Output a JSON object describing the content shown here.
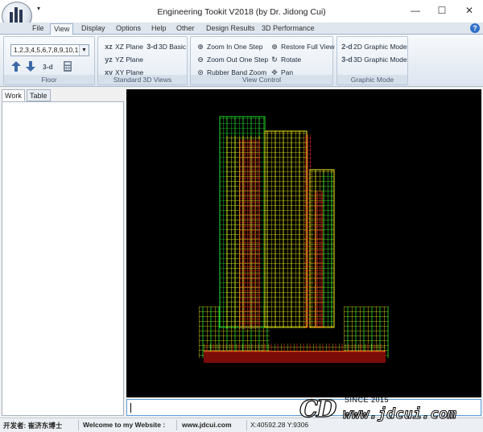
{
  "window": {
    "title": "Engineering Tookit V2018 (by Dr. Jidong Cui)",
    "qat_label": "▾",
    "controls": {
      "minimize": "—",
      "maximize": "☐",
      "close": "✕"
    }
  },
  "menu_tabs": [
    "File",
    "View",
    "Display",
    "Options",
    "Help",
    "Other",
    "Design Results",
    "3D Performance"
  ],
  "active_tab": "View",
  "help_label": "?",
  "ribbon": {
    "floor": {
      "label": "Floor",
      "selected": "1,2,3,4,5,6,7,8,9,10,1",
      "three_d_label": "3-d"
    },
    "standard_views": {
      "label": "Standard 3D Views",
      "buttons": [
        {
          "icon": "xz",
          "label": "XZ Plane"
        },
        {
          "icon": "yz",
          "label": "YZ Plane"
        },
        {
          "icon": "xy",
          "label": "XY Plane"
        },
        {
          "icon": "3-d",
          "label": "3D Basic"
        }
      ]
    },
    "view_control": {
      "label": "View Control",
      "buttons": [
        {
          "icon": "zoom-in-icon",
          "glyph": "⊕",
          "label": "Zoom In One Step"
        },
        {
          "icon": "zoom-out-icon",
          "glyph": "⊖",
          "label": "Zoom Out One Step"
        },
        {
          "icon": "rubber-band-zoom-icon",
          "glyph": "⊙",
          "label": "Rubber Band Zoom"
        },
        {
          "icon": "restore-full-view-icon",
          "glyph": "⊛",
          "label": "Restore Full View"
        },
        {
          "icon": "rotate-icon",
          "glyph": "↻",
          "label": "Rotate"
        },
        {
          "icon": "pan-icon",
          "glyph": "✥",
          "label": "Pan"
        }
      ]
    },
    "graphic_mode": {
      "label": "Graphic Mode",
      "buttons": [
        {
          "icon": "2-d",
          "label": "2D Graphic Mode"
        },
        {
          "icon": "3-d",
          "label": "3D Graphic Mode"
        }
      ]
    }
  },
  "side_tabs": [
    "Work",
    "Table"
  ],
  "active_side_tab": "Work",
  "status": {
    "developer": "开发者: 崔济东博士",
    "welcome": "Welcome to my Website :",
    "website": "www.jdcui.com",
    "coords": "X:40592.28 Y:9306"
  },
  "watermark": {
    "logo_text": "CD",
    "since": "SINCE 2015",
    "url": "www.jdcui.com"
  },
  "colors": {
    "viewport_bg": "#000000",
    "model_green": "#22e02a",
    "model_yellow": "#f2f21a",
    "model_red": "#c21a14",
    "model_dark_red": "#7a0d08"
  }
}
